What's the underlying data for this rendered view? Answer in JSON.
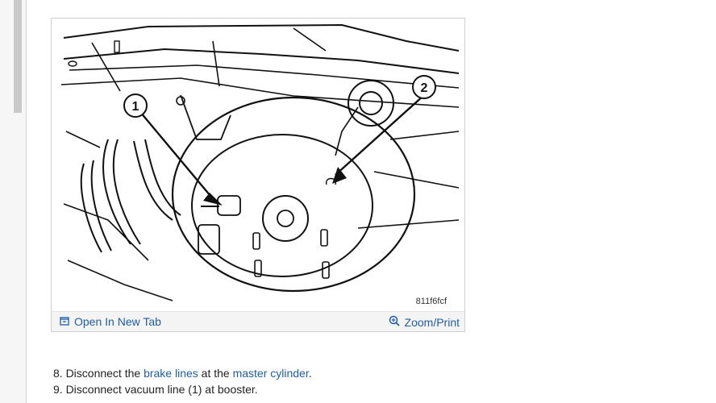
{
  "figure": {
    "callouts": [
      "1",
      "2"
    ],
    "figure_id": "811f6fcf",
    "open_tab_label": "Open In New Tab",
    "zoom_label": "Zoom/Print",
    "open_tab_icon": "open-in-new-tab-icon",
    "zoom_icon": "zoom-in-icon"
  },
  "steps": [
    {
      "prefix": "8. Disconnect the ",
      "link1": "brake lines",
      "mid": " at the ",
      "link2": "master cylinder",
      "suffix": "."
    },
    {
      "text": "9. Disconnect vacuum line (1) at booster."
    }
  ]
}
